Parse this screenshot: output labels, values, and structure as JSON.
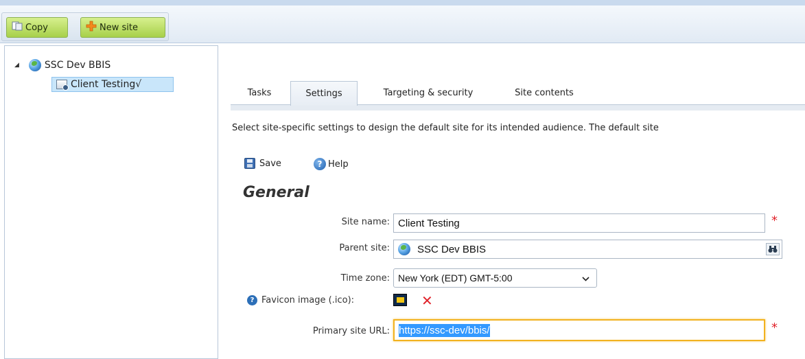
{
  "toolbar": {
    "copy_label": "Copy",
    "new_site_label": "New site"
  },
  "tree": {
    "root_label": "SSC Dev BBIS",
    "child_label": "Client Testing√"
  },
  "tabs": [
    {
      "label": "Tasks"
    },
    {
      "label": "Settings"
    },
    {
      "label": "Targeting & security"
    },
    {
      "label": "Site contents"
    }
  ],
  "active_tab": "Settings",
  "intro_text": "Select site-specific settings to design the default site for its intended audience. The default site",
  "actions": {
    "save_label": "Save",
    "help_label": "Help"
  },
  "section_title": "General",
  "form": {
    "site_name": {
      "label": "Site name:",
      "value": "Client Testing",
      "required_mark": "*"
    },
    "parent_site": {
      "label": "Parent site:",
      "value": "SSC Dev BBIS"
    },
    "time_zone": {
      "label": "Time zone:",
      "value": "New York (EDT) GMT-5:00"
    },
    "favicon": {
      "label": "Favicon image (.ico):"
    },
    "primary_url": {
      "label": "Primary site URL:",
      "value": "https://ssc-dev/bbis/",
      "required_mark": "*"
    }
  },
  "colors": {
    "button_green": "#a7d04a",
    "required_red": "#e0222a",
    "focus_orange": "#f2b21f",
    "selection_blue": "#3399ff"
  }
}
